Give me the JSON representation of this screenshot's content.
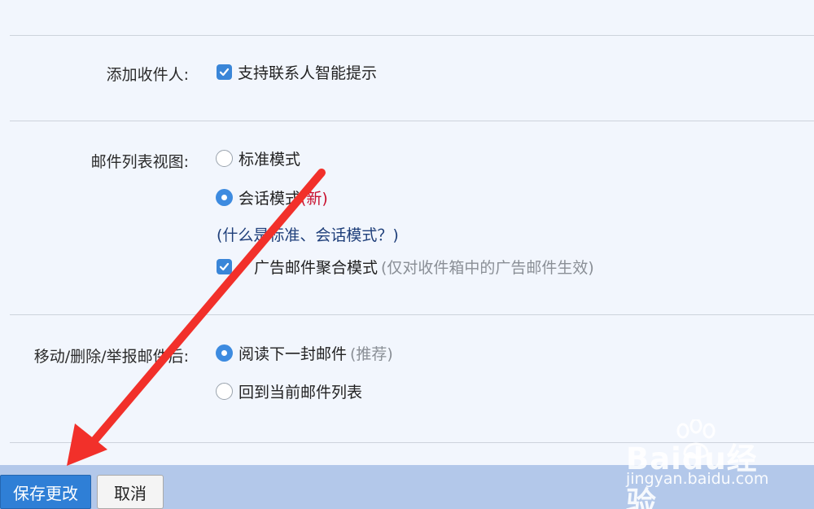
{
  "settings": {
    "add_recipient": {
      "label": "添加收件人:",
      "option": "支持联系人智能提示"
    },
    "list_view": {
      "label": "邮件列表视图:",
      "standard_mode": "标准模式",
      "conversation_mode": "会话模式",
      "new_tag": "(新)",
      "help_link": "(什么是标准、会话模式？)",
      "ad_aggregate": "广告邮件聚合模式",
      "ad_aggregate_note": "(仅对收件箱中的广告邮件生效)"
    },
    "after_action": {
      "label": "移动/删除/举报邮件后:",
      "read_next": "阅读下一封邮件",
      "recommended": "(推荐)",
      "back_to_list": "回到当前邮件列表"
    }
  },
  "footer": {
    "save_label": "保存更改",
    "cancel_label": "取消"
  },
  "watermark": {
    "logo": "Baidu经验",
    "url": "jingyan.baidu.com"
  },
  "colors": {
    "accent": "#3a86d8",
    "annotation_arrow": "#f2302a",
    "new_tag": "#c8102e"
  }
}
